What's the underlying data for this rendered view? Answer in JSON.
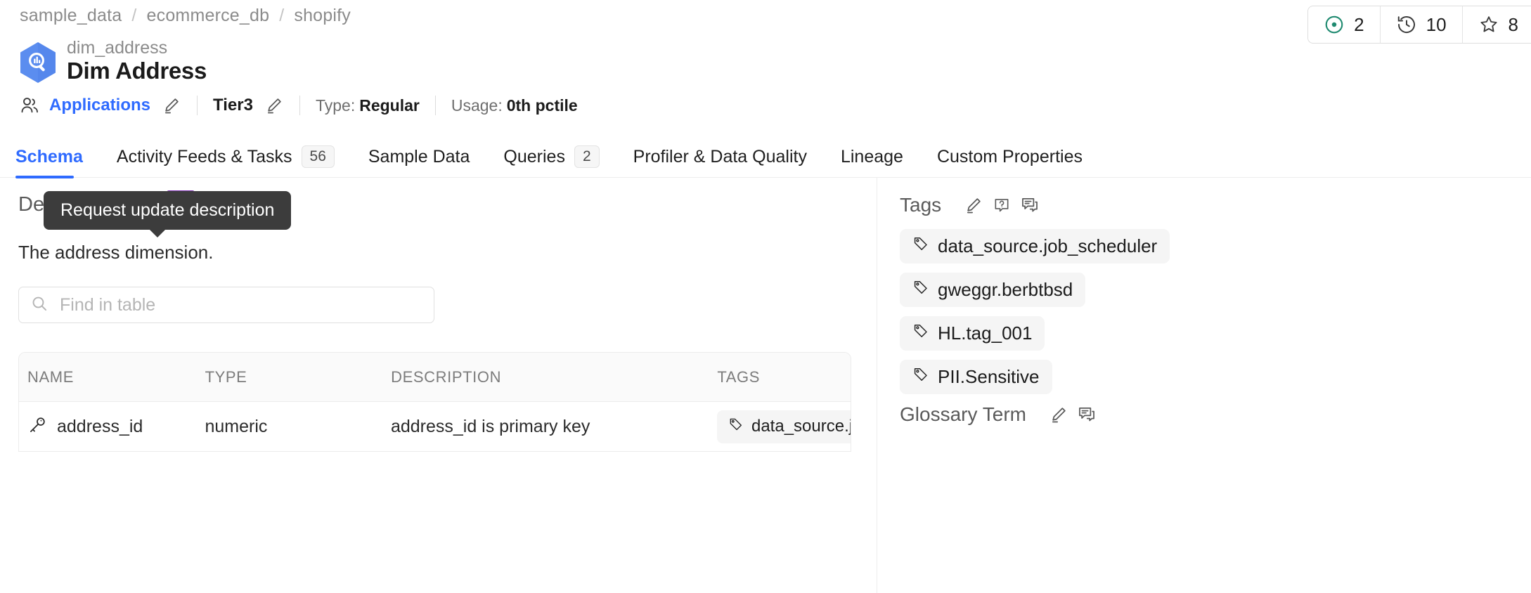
{
  "breadcrumb": {
    "items": [
      "sample_data",
      "ecommerce_db",
      "shopify"
    ],
    "separator": "/"
  },
  "stats": [
    {
      "icon": "announcement-dot-icon",
      "value": "2",
      "color": "#1f8a70"
    },
    {
      "icon": "history-clock-icon",
      "value": "10",
      "color": "#3c3c3c"
    },
    {
      "icon": "star-outline-icon",
      "value": "8",
      "color": "#3c3c3c"
    }
  ],
  "header": {
    "logo_icon": "bigquery-hexagon-icon",
    "subtitle": "dim_address",
    "title": "Dim Address"
  },
  "meta": {
    "owner_icon": "users-icon",
    "owner": "Applications",
    "owner_edit_icon": "pencil-icon",
    "tier": "Tier3",
    "tier_edit_icon": "pencil-icon",
    "type_label": "Type:",
    "type_value": "Regular",
    "usage_label": "Usage:",
    "usage_value": "0th pctile"
  },
  "tabs": [
    {
      "label": "Schema",
      "badge": "",
      "active": true
    },
    {
      "label": "Activity Feeds & Tasks",
      "badge": "56",
      "active": false
    },
    {
      "label": "Sample Data",
      "badge": "",
      "active": false
    },
    {
      "label": "Queries",
      "badge": "2",
      "active": false
    },
    {
      "label": "Profiler & Data Quality",
      "badge": "",
      "active": false
    },
    {
      "label": "Lineage",
      "badge": "",
      "active": false
    },
    {
      "label": "Custom Properties",
      "badge": "",
      "active": false
    }
  ],
  "tooltip": {
    "text": "Request update description"
  },
  "description": {
    "heading": "Description",
    "edit_icon": "pencil-icon",
    "request_icon": "question-bubble-icon",
    "comment_icon": "comment-icon",
    "text": "The address dimension."
  },
  "search": {
    "icon": "search-icon",
    "placeholder": "Find in table",
    "value": ""
  },
  "table": {
    "columns": [
      "NAME",
      "TYPE",
      "DESCRIPTION",
      "TAGS"
    ],
    "rows": [
      {
        "key_icon": "key-icon",
        "name": "address_id",
        "type": "numeric",
        "description": "address_id is primary key",
        "tag_icon": "tag-icon",
        "tag": "data_source.job"
      }
    ]
  },
  "sidebar": {
    "tags_section": {
      "heading": "Tags",
      "edit_icon": "pencil-icon",
      "request_icon": "question-bubble-icon",
      "comment_icon": "comment-icon",
      "tags": [
        "data_source.job_scheduler",
        "gweggr.berbtbsd",
        "HL.tag_001",
        "PII.Sensitive"
      ],
      "tag_icon": "tag-icon"
    },
    "glossary_section": {
      "heading": "Glossary Term",
      "edit_icon": "pencil-icon",
      "comment_icon": "comment-icon"
    }
  },
  "colors": {
    "accent_blue": "#2f6bff",
    "highlight_purple": "#7b2db0",
    "teal": "#1f8a70",
    "muted_text": "#8b8b8b"
  }
}
